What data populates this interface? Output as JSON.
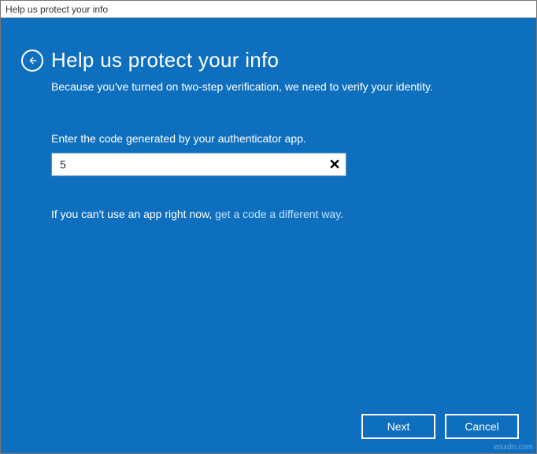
{
  "window": {
    "title": "Help us protect your info"
  },
  "header": {
    "title": "Help us protect your info",
    "subtitle": "Because you've turned on two-step verification, we need to verify your identity."
  },
  "form": {
    "label": "Enter the code generated by your authenticator app.",
    "code_value": "5",
    "clear_glyph": "✕"
  },
  "help": {
    "prefix": "If you can't use an app right now, ",
    "link_text": "get a code a different way",
    "suffix": "."
  },
  "buttons": {
    "next": "Next",
    "cancel": "Cancel"
  },
  "watermark": "wsxdn.com"
}
